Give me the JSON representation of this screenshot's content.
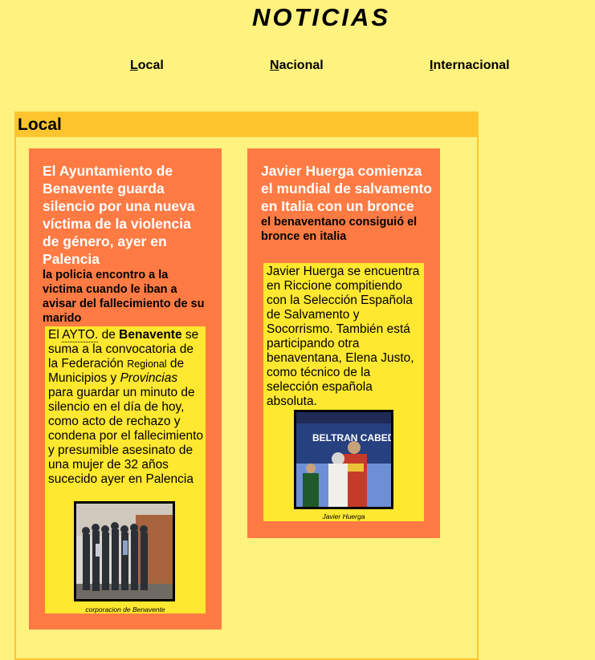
{
  "page": {
    "title": "NOTICIAS"
  },
  "nav": {
    "items": [
      {
        "first": "L",
        "rest": "ocal"
      },
      {
        "first": "N",
        "rest": "acional"
      },
      {
        "first": "I",
        "rest": "nternacional"
      }
    ]
  },
  "section": {
    "header": "Local"
  },
  "articles": [
    {
      "headline": "El Ayuntamiento de Benavente guarda silencio por una nueva víctima de la violencia de género, ayer en Palencia",
      "subheadline": "la policia encontro a la victima cuando le iban a avisar del fallecimiento de su marido",
      "body": {
        "p1": "El ",
        "abbr": "AYTO.",
        "p2": " de ",
        "strong": "Benavente",
        "p3": " se suma a la convocatoria de la Federación ",
        "small": "Regional",
        "p4": " de Municipios y ",
        "em": "Provincias",
        "p5": " para guardar un minuto de silencio en el día de hoy, como acto de rechazo y condena por el fallecimiento y presumible asesinato de una mujer de 32 años sucecido ayer en Palencia"
      },
      "image_caption": "corporacion de Benavente"
    },
    {
      "headline": "Javier Huerga comienza el mundial de salvamento en Italia con un bronce",
      "subheadline": "el benaventano consiguió el bronce en italia",
      "body": {
        "text": "Javier Huerga se encuentra en Riccione compitiendo con la Selección Española de Salvamento y Socorrismo. También está participando otra benaventana, Elena Justo, como técnico de la selección española absoluta."
      },
      "image_caption": "Javier Huerga",
      "image_banner_text": "BELTRAN CABEDO"
    }
  ],
  "colors": {
    "page_bg": "#fff27f",
    "section_header": "#ffc52e",
    "card_bg": "#ff7b43",
    "body_bg": "#ffe82f"
  }
}
